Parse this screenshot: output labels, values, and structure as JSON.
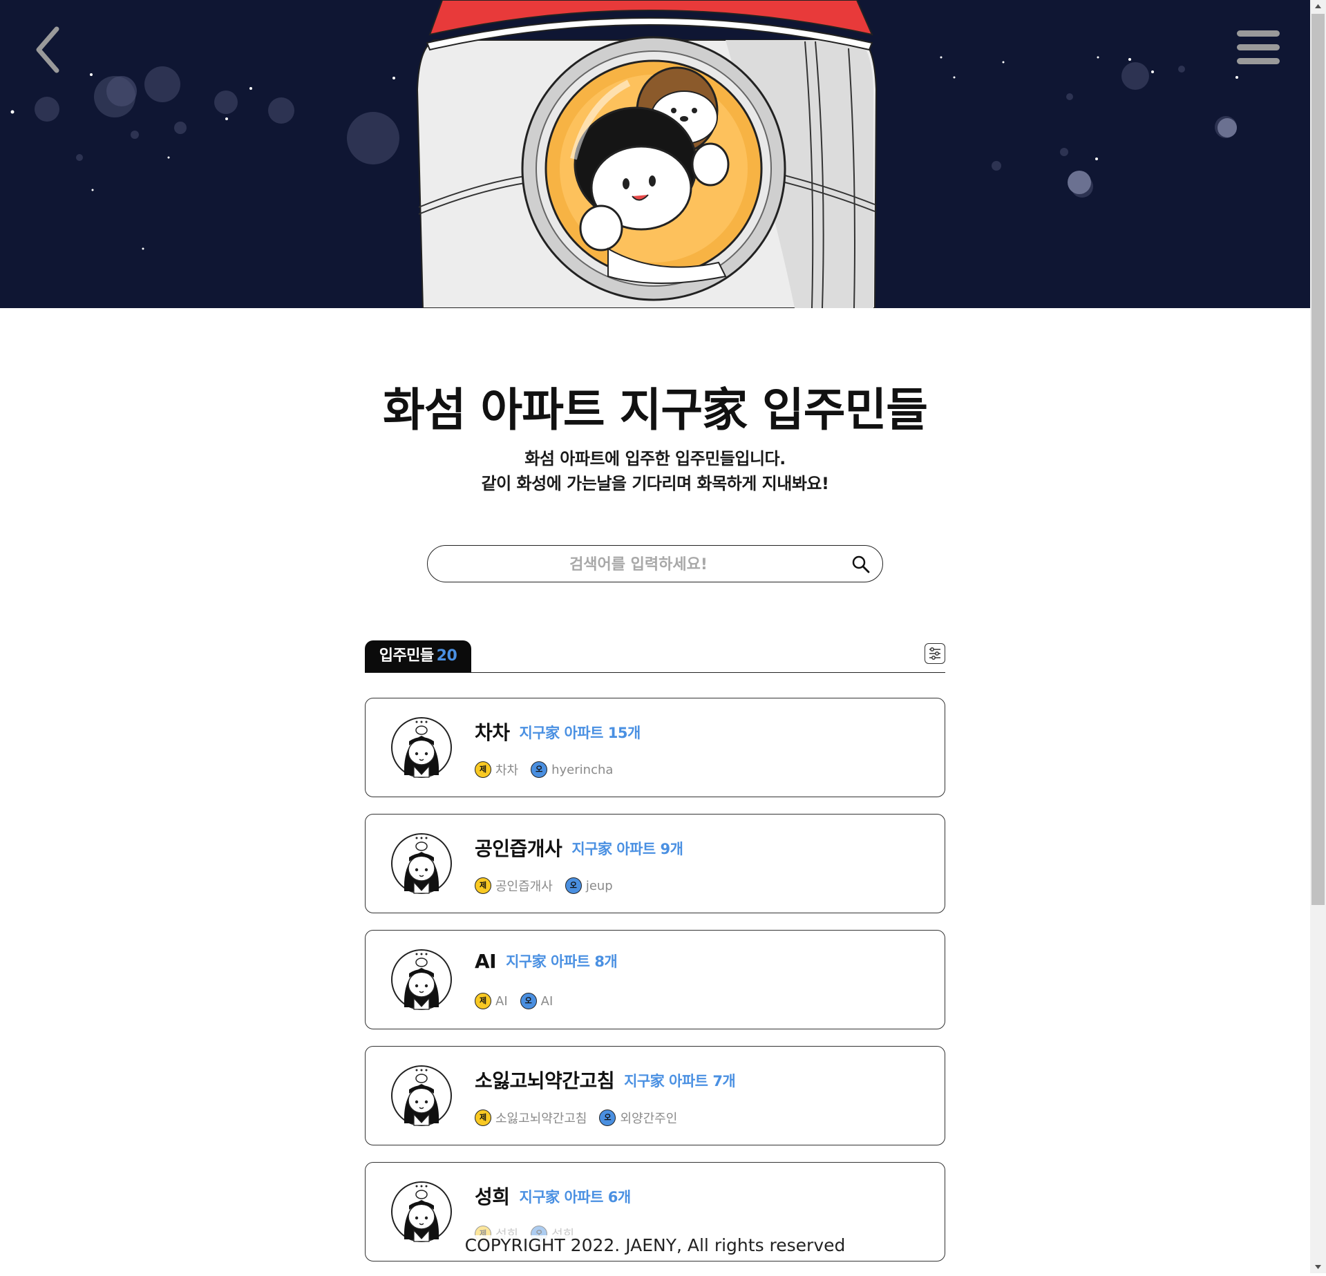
{
  "nav": {
    "back_icon": "chevron-left-icon",
    "menu_icon": "hamburger-menu-icon"
  },
  "intro": {
    "title": "화섬 아파트 지구家 입주민들",
    "subtitle_line1": "화섬 아파트에 입주한 입주민들입니다.",
    "subtitle_line2": "같이 화성에 가는날을 기다리며 화목하게 지내봐요!"
  },
  "search": {
    "placeholder": "검색어를 입력하세요!",
    "value": "",
    "icon": "search-icon"
  },
  "tabs": {
    "residents_label": "입주민들",
    "residents_count": "20",
    "filter_icon": "filter-sliders-icon"
  },
  "residents": [
    {
      "name": "차차",
      "count_text": "지구家 아파트 15개",
      "je_badge": "제",
      "je_value": "차차",
      "o_badge": "오",
      "o_value": "hyerincha"
    },
    {
      "name": "공인즙개사",
      "count_text": "지구家 아파트 9개",
      "je_badge": "제",
      "je_value": "공인즙개사",
      "o_badge": "오",
      "o_value": "jeup"
    },
    {
      "name": "AI",
      "count_text": "지구家 아파트 8개",
      "je_badge": "제",
      "je_value": "AI",
      "o_badge": "오",
      "o_value": "AI"
    },
    {
      "name": "소잃고뇌약간고침",
      "count_text": "지구家 아파트 7개",
      "je_badge": "제",
      "je_value": "소잃고뇌약간고침",
      "o_badge": "오",
      "o_value": "외양간주인"
    },
    {
      "name": "성희",
      "count_text": "지구家 아파트 6개",
      "je_badge": "제",
      "je_value": "성희",
      "o_badge": "오",
      "o_value": "성희"
    }
  ],
  "footer": {
    "copyright": "COPYRIGHT 2022. JAENY, All rights reserved"
  },
  "colors": {
    "hero_bg": "#0f1633",
    "accent_blue": "#4a90e2",
    "badge_yellow": "#f9c923",
    "badge_blue": "#4a8fe0"
  }
}
